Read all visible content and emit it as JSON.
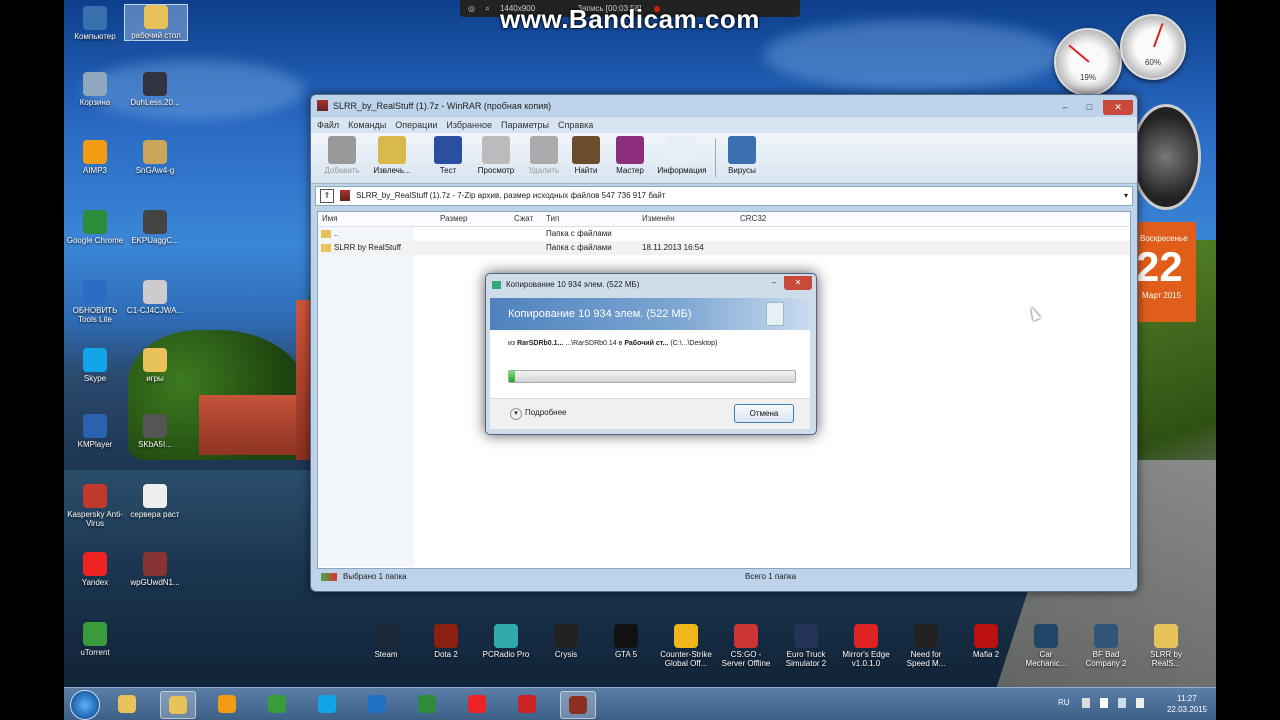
{
  "recorder": {
    "size_text": "1440x900",
    "record_text": "Запись [00:03:58]",
    "watermark": "www.Bandicam.com"
  },
  "desktop": {
    "icons_left": [
      {
        "label": "Компьютер",
        "icon": "computer-icon",
        "color": "#3a6fb0"
      },
      {
        "label": "рабочий стол",
        "icon": "folder-icon",
        "color": "#e8c25a"
      },
      {
        "label": "Корзина",
        "icon": "recycle-bin-icon",
        "color": "#8fa6bf"
      },
      {
        "label": "DuhLess.20...",
        "icon": "video-file-icon",
        "color": "#334"
      },
      {
        "label": "AIMP3",
        "icon": "aimp-icon",
        "color": "#f39c12"
      },
      {
        "label": "SnGAw4-g",
        "icon": "image-file-icon",
        "color": "#c9a65a"
      },
      {
        "label": "Google Chrome",
        "icon": "chrome-icon",
        "color": "#2c8c3c"
      },
      {
        "label": "EKPUaggC...",
        "icon": "image-file-icon",
        "color": "#444"
      },
      {
        "label": "ОБНОВИТЬ Tools Lite",
        "icon": "daemon-tools-icon",
        "color": "#2b6cc4"
      },
      {
        "label": "C1-CJ4CJWA...",
        "icon": "image-file-icon",
        "color": "#ccc"
      },
      {
        "label": "Skype",
        "icon": "skype-icon",
        "color": "#12a5e8"
      },
      {
        "label": "игры",
        "icon": "folder-icon",
        "color": "#e8c25a"
      },
      {
        "label": "KMPlayer",
        "icon": "kmplayer-icon",
        "color": "#2a62b0"
      },
      {
        "label": "SKbA5I...",
        "icon": "image-file-icon",
        "color": "#555"
      },
      {
        "label": "Kaspersky Anti-Virus",
        "icon": "kaspersky-icon",
        "color": "#c0392b"
      },
      {
        "label": "сервера раст",
        "icon": "text-file-icon",
        "color": "#eee"
      },
      {
        "label": "Yandex",
        "icon": "yandex-icon",
        "color": "#e22"
      },
      {
        "label": "wpGUwdN1...",
        "icon": "image-file-icon",
        "color": "#833"
      },
      {
        "label": "uTorrent",
        "icon": "utorrent-icon",
        "color": "#3a9b3a"
      }
    ],
    "icons_bottom": [
      {
        "label": "Steam",
        "icon": "steam-icon",
        "color": "#1b2838"
      },
      {
        "label": "Dota 2",
        "icon": "dota2-icon",
        "color": "#8b1f12"
      },
      {
        "label": "PCRadio Pro",
        "icon": "radio-icon",
        "color": "#3aa"
      },
      {
        "label": "Crysis",
        "icon": "crysis-icon",
        "color": "#222"
      },
      {
        "label": "GTA 5",
        "icon": "gta-icon",
        "color": "#111"
      },
      {
        "label": "Counter-Strike Global Off...",
        "icon": "csgo-icon",
        "color": "#f1b61c"
      },
      {
        "label": "CS:GO - Server Offline",
        "icon": "csgo-server-icon",
        "color": "#c33"
      },
      {
        "label": "Euro Truck Simulator 2",
        "icon": "ets2-icon",
        "color": "#235"
      },
      {
        "label": "Mirror's Edge v1.0.1.0",
        "icon": "mirrors-edge-icon",
        "color": "#d22"
      },
      {
        "label": "Need for Speed M...",
        "icon": "nfs-icon",
        "color": "#222"
      },
      {
        "label": "Mafia 2",
        "icon": "mafia2-icon",
        "color": "#b11"
      },
      {
        "label": "Car Mechanic...",
        "icon": "car-mechanic-icon",
        "color": "#246"
      },
      {
        "label": "BF Bad Company 2",
        "icon": "bf-icon",
        "color": "#357"
      },
      {
        "label": "SLRR by RealS...",
        "icon": "folder-icon",
        "color": "#e8c25a"
      }
    ]
  },
  "gadgets": {
    "cpu_percent": "19%",
    "ram_percent": "60%",
    "calendar_day": "Воскресенье",
    "calendar_num": "22",
    "calendar_monthyear": "Март 2015"
  },
  "winrar": {
    "title": "SLRR_by_RealStuff (1).7z - WinRAR (пробная копия)",
    "menu": [
      "Файл",
      "Команды",
      "Операции",
      "Избранное",
      "Параметры",
      "Справка"
    ],
    "toolbar": [
      {
        "label": "Добавить",
        "icon": "add-archive-icon",
        "color": "#999",
        "disabled": true
      },
      {
        "label": "Извлечь...",
        "icon": "extract-icon",
        "color": "#d9b94a",
        "disabled": false
      },
      {
        "label": "Тест",
        "icon": "test-icon",
        "color": "#2a4fa0",
        "disabled": false
      },
      {
        "label": "Просмотр",
        "icon": "view-icon",
        "color": "#bbb",
        "disabled": false
      },
      {
        "label": "Удалить",
        "icon": "delete-icon",
        "color": "#aaa",
        "disabled": true
      },
      {
        "label": "Найти",
        "icon": "find-icon",
        "color": "#6b4c2b",
        "disabled": false
      },
      {
        "label": "Мастер",
        "icon": "wizard-icon",
        "color": "#8b2f7a",
        "disabled": false
      },
      {
        "label": "Информация",
        "icon": "info-icon",
        "color": "#e8eef6",
        "disabled": false
      },
      {
        "label": "Вирусы",
        "icon": "virus-scan-icon",
        "color": "#3a6fb0",
        "disabled": false
      }
    ],
    "path_text": "SLRR_by_RealStuff (1).7z - 7-Zip архив, размер исходных файлов 547 736 917 байт",
    "columns": [
      "Имя",
      "Размер",
      "Сжат",
      "Тип",
      "Изменён",
      "CRC32"
    ],
    "rows": [
      {
        "name": "..",
        "size": "",
        "packed": "",
        "type": "Папка с файлами",
        "modified": "",
        "crc": ""
      },
      {
        "name": "SLRR by RealStuff",
        "size": "",
        "packed": "",
        "type": "Папка с файлами",
        "modified": "18.11.2013 16:54",
        "crc": ""
      }
    ],
    "status_left": "Выбрано 1 папка",
    "status_right": "Всего 1 папка"
  },
  "copy_dialog": {
    "title": "Копирование 10 934 элем. (522 МБ)",
    "header": "Копирование 10 934 элем. (522 МБ)",
    "line_from": "из",
    "source": "RarSDRb0.1...",
    "source_path": "...\\RarSDRb0.14",
    "line_to": "в",
    "dest": "Рабочий ст...",
    "dest_path": "(C:\\...\\Desktop)",
    "progress": 0.02,
    "more_label": "Подробнее",
    "cancel_label": "Отмена"
  },
  "taskbar": {
    "items": [
      {
        "icon": "explorer-icon",
        "color": "#e8c25a",
        "active": false
      },
      {
        "icon": "folder-icon",
        "color": "#e8c25a",
        "active": true
      },
      {
        "icon": "media-player-icon",
        "color": "#f39c12",
        "active": false
      },
      {
        "icon": "utorrent-icon",
        "color": "#3a9b3a",
        "active": false
      },
      {
        "icon": "skype-icon",
        "color": "#12a5e8",
        "active": false
      },
      {
        "icon": "ie-icon",
        "color": "#1e70c8",
        "active": false
      },
      {
        "icon": "chrome-icon",
        "color": "#2c8c3c",
        "active": false
      },
      {
        "icon": "yandex-icon",
        "color": "#e22",
        "active": false
      },
      {
        "icon": "bandicam-icon",
        "color": "#c22",
        "active": false
      },
      {
        "icon": "winrar-icon",
        "color": "#8b2f20",
        "active": true
      }
    ],
    "lang": "RU",
    "time": "11:27",
    "date": "22.03.2015"
  }
}
